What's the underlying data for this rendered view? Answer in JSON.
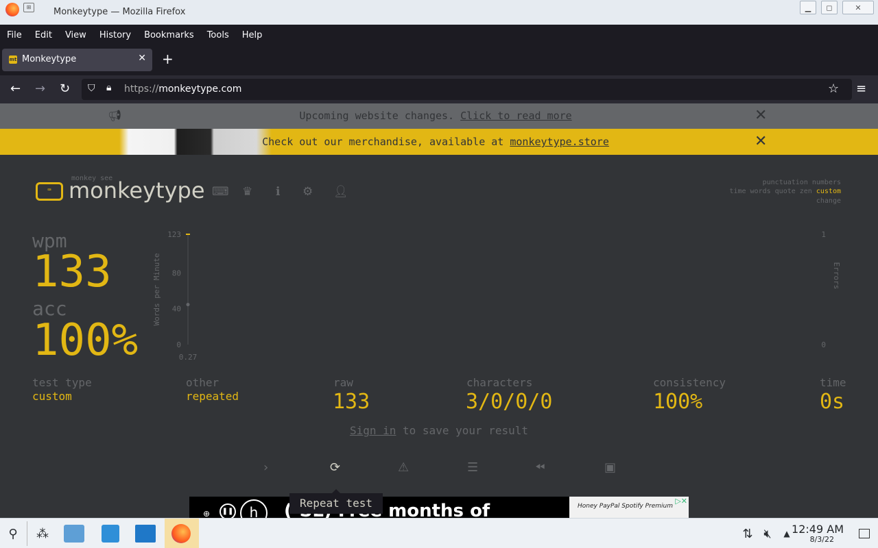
{
  "window": {
    "title": "Monkeytype — Mozilla Firefox"
  },
  "menu": [
    "File",
    "Edit",
    "View",
    "History",
    "Bookmarks",
    "Tools",
    "Help"
  ],
  "tab": {
    "favicon_text": "mt",
    "title": "Monkeytype"
  },
  "url": {
    "prefix": "https://",
    "domain": "monkeytype.com"
  },
  "banners": {
    "notice_text": "Upcoming website changes. ",
    "notice_link": "Click to read more",
    "merch_text": "Check out our merchandise, available at ",
    "merch_link": "monkeytype.store"
  },
  "app": {
    "logo_small": "monkey see",
    "logo_text": "monkeytype",
    "config": {
      "line1": "punctuation numbers",
      "line2": "time words quote zen",
      "line2_active": "custom",
      "line3": "change"
    }
  },
  "result": {
    "wpm_label": "wpm",
    "wpm": "133",
    "acc_label": "acc",
    "acc": "100%",
    "test_type_label": "test type",
    "test_type": "custom",
    "other_label": "other",
    "other": "repeated",
    "raw_label": "raw",
    "raw": "133",
    "characters_label": "characters",
    "characters": "3/0/0/0",
    "consistency_label": "consistency",
    "consistency": "100%",
    "time_label": "time",
    "time": "0s",
    "signin_link": "Sign in",
    "signin_rest": " to save your result",
    "tooltip": "Repeat test"
  },
  "chart_data": {
    "type": "line",
    "ylabel": "Words per Minute",
    "y2label": "Errors",
    "y_ticks": [
      "123",
      "80",
      "40",
      "0"
    ],
    "y2_ticks": [
      "1",
      "0"
    ],
    "x_ticks": [
      "0.27"
    ],
    "ylim": [
      0,
      123
    ],
    "y2lim": [
      0,
      1
    ],
    "series": [
      {
        "x": [
          0.27
        ],
        "values": [
          133
        ]
      }
    ]
  },
  "ad": {
    "text": "(-SL) Free months of",
    "sponsors": "Honey PayPal  Spotify Premium"
  },
  "taskbar": {
    "time": "12:49 AM",
    "date": "8/3/22"
  },
  "colors": {
    "main": "#e2b714",
    "sub": "#646669",
    "bg": "#323437",
    "text": "#d1d0c5"
  }
}
